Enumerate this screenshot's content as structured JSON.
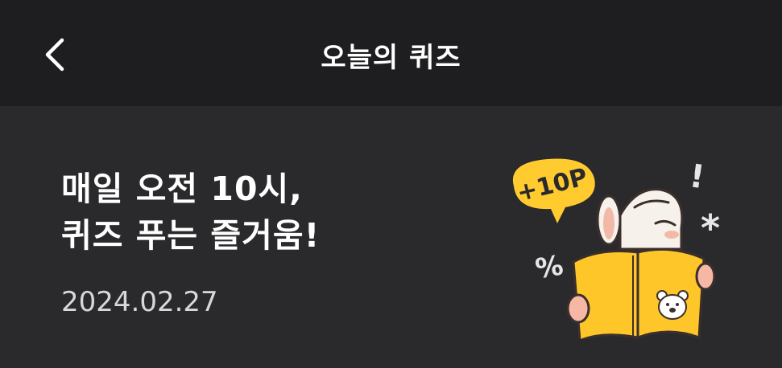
{
  "header": {
    "title": "오늘의 퀴즈",
    "back_icon": "chevron-left-icon"
  },
  "main": {
    "headline_line1": "매일 오전 10시,",
    "headline_line2": "퀴즈 푸는 즐거움!",
    "date": "2024.02.27"
  },
  "illustration": {
    "badge_text": "+10P",
    "exclaim": "!",
    "percent": "%",
    "asterisk": "*",
    "colors": {
      "badge_yellow": "#ffcb2f",
      "book_yellow": "#ffc629",
      "skin": "#f6b7a4",
      "background_dark": "#2a2a2c",
      "header_dark": "#1e1e20"
    }
  }
}
